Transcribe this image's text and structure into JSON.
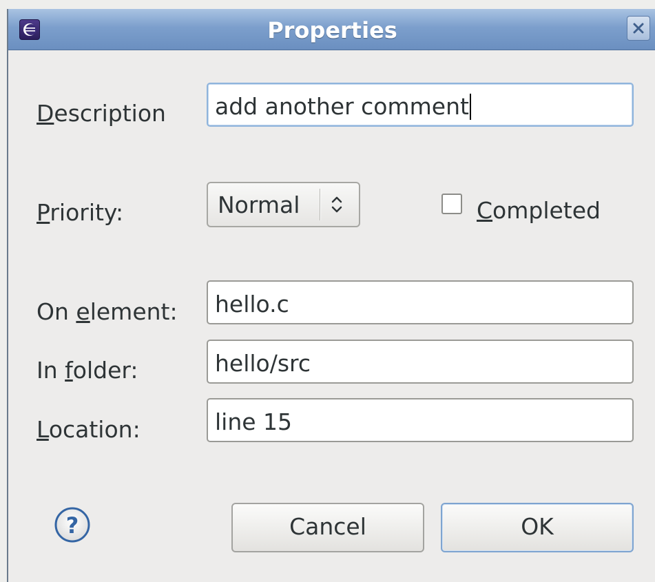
{
  "window": {
    "title": "Properties",
    "close_icon": "close-icon",
    "app_icon": "eclipse-icon"
  },
  "form": {
    "description": {
      "label_mnemonic": "D",
      "label_rest": "escription",
      "value": "add another comment"
    },
    "priority": {
      "label_mnemonic": "P",
      "label_rest": "riority:",
      "selected": "Normal"
    },
    "completed": {
      "label_mnemonic": "C",
      "label_rest": "ompleted",
      "checked": false
    },
    "on_element": {
      "label_before": "On ",
      "label_mnemonic": "e",
      "label_rest": "lement:",
      "value": "hello.c"
    },
    "in_folder": {
      "label_before": "In ",
      "label_mnemonic": "f",
      "label_rest": "older:",
      "value": "hello/src"
    },
    "location": {
      "label_mnemonic": "L",
      "label_rest": "ocation:",
      "value": "line 15"
    }
  },
  "buttons": {
    "help_icon": "help-icon",
    "cancel": "Cancel",
    "ok": "OK"
  },
  "colors": {
    "titlebar": "#7c9fcc",
    "dialog_bg": "#edeceb",
    "focus_border": "#8fb4dc"
  }
}
